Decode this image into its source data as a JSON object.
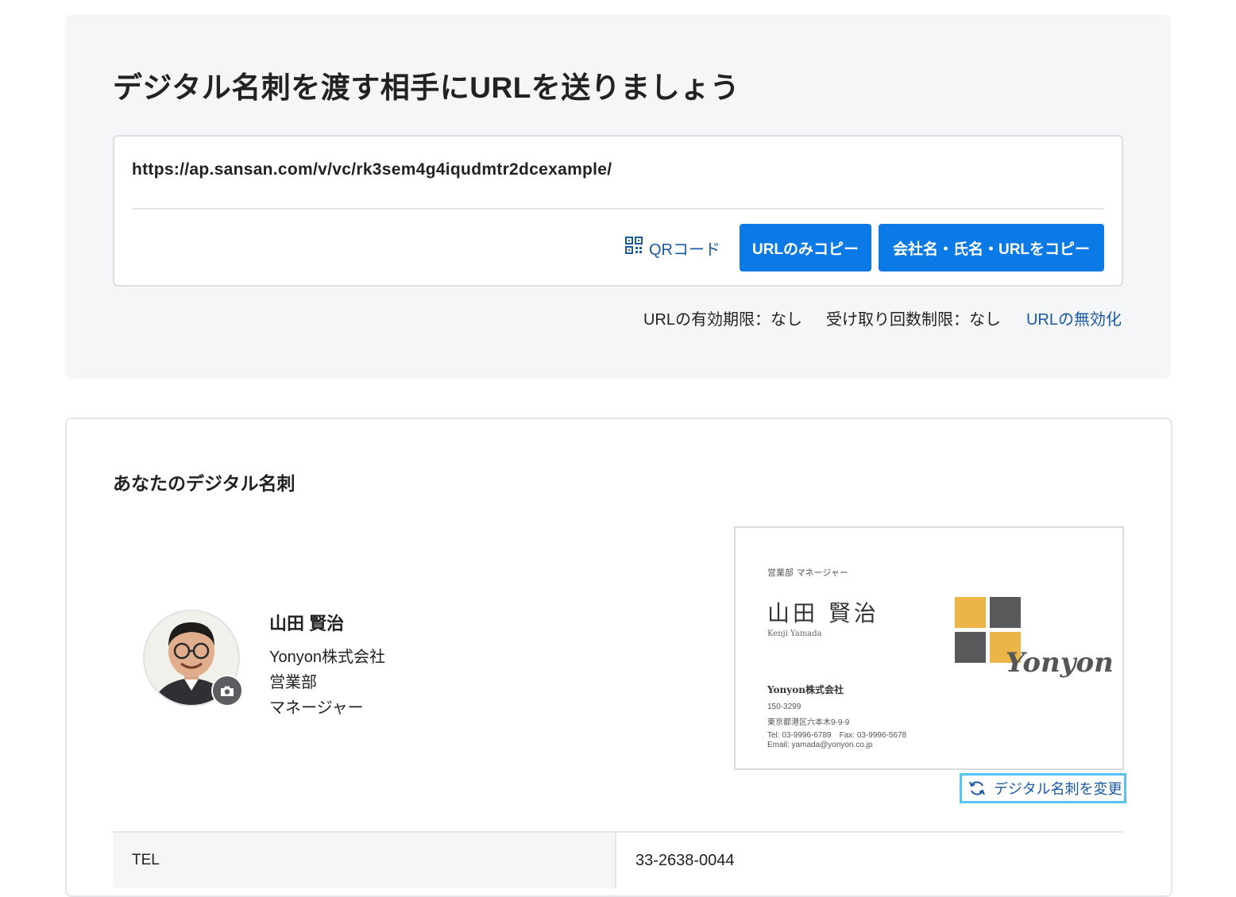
{
  "share": {
    "title": "デジタル名刺を渡す相手にURLを送りましょう",
    "url": "https://ap.sansan.com/v/vc/rk3sem4g4iqudmtr2dcexample/",
    "qr_label": "QRコード",
    "copy_url_label": "URLのみコピー",
    "copy_all_label": "会社名・氏名・URLをコピー",
    "expiry": "URLの有効期限：なし",
    "receive_limit": "受け取り回数制限：なし",
    "revoke_label": "URLの無効化",
    "colors": {
      "primary_button": "#0b79e6",
      "link": "#1a5aa5"
    }
  },
  "card_section": {
    "title": "あなたのデジタル名刺",
    "profile": {
      "name": "山田 賢治",
      "company": "Yonyon株式会社",
      "department": "営業部",
      "position": "マネージャー"
    },
    "business_card": {
      "title_line": "営業部 マネージャー",
      "name": "山田 賢治",
      "roman_name": "Kenji Yamada",
      "company": "Yonyon株式会社",
      "postal": "150-3299",
      "address": "東京都港区六本木9-9-9",
      "tel_fax": "Tel: 03-9996-6789　Fax: 03-9996-5678",
      "email": "Email: yamada@yonyon.co.jp",
      "brand": "Yonyon",
      "logo_colors": {
        "yellow": "#ebb547",
        "gray": "#58595b"
      }
    },
    "change_label": "デジタル名刺を変更",
    "info_rows": [
      {
        "label": "TEL",
        "value": "33-2638-0044"
      }
    ]
  }
}
